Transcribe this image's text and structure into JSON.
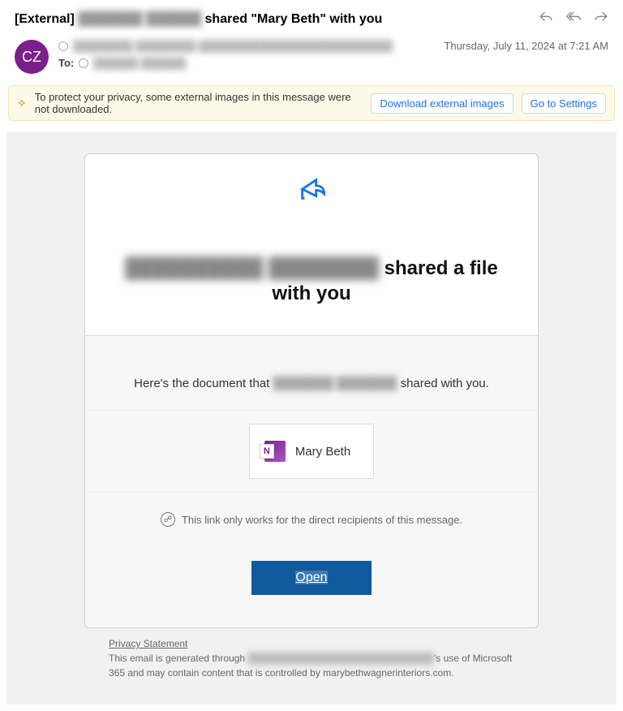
{
  "header": {
    "subject_prefix": "[External]",
    "subject_redacted": "███████ ██████",
    "subject_suffix": " shared \"Mary Beth\" with you",
    "timestamp": "Thursday, July 11, 2024 at 7:21 AM",
    "avatar_initials": "CZ",
    "from_redacted": "████████ ████████  ██████████████████████████",
    "to_label": "To:",
    "to_redacted": "██████ ██████"
  },
  "banner": {
    "text": "To protect your privacy, some external images in this message were not downloaded.",
    "download_label": "Download external images",
    "settings_label": "Go to Settings"
  },
  "card": {
    "headline_redacted": "██████████ ████████",
    "headline_suffix": " shared a file with you",
    "doc_prefix": "Here's the document that ",
    "doc_redacted": "███████ ███████",
    "doc_suffix": " shared with you.",
    "file_name": "Mary Beth",
    "notice_text": "This link only works for the direct recipients of this message.",
    "open_label": "Open"
  },
  "footer": {
    "privacy_label": "Privacy Statement",
    "line2_prefix": "This email is generated through ",
    "line2_redacted": "███████████████████████████",
    "line2_suffix": "'s use of Microsoft 365 and may contain content that is controlled by marybethwagnerinteriors.com."
  }
}
